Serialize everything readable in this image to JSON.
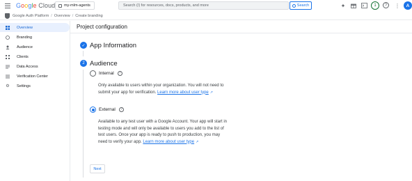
{
  "topbar": {
    "logo_text": "Google Cloud",
    "project_name": "my-mlm-agents",
    "search_placeholder": "Search (/) for resources, docs, products, and more",
    "search_button": "Search",
    "notification_count": "1",
    "avatar_initial": "A",
    "icons": [
      "menu-icon",
      "gemini-icon",
      "gift-icon",
      "terminal-icon",
      "help-icon",
      "more-vert-icon"
    ]
  },
  "breadcrumb": {
    "items": [
      "Google Auth Platform",
      "Overview",
      "Create branding"
    ],
    "separator": "/"
  },
  "sidebar": {
    "items": [
      {
        "label": "Overview",
        "icon": "grid-icon",
        "active": true
      },
      {
        "label": "Branding",
        "icon": "palette-icon",
        "active": false
      },
      {
        "label": "Audience",
        "icon": "people-icon",
        "active": false
      },
      {
        "label": "Clients",
        "icon": "clients-icon",
        "active": false
      },
      {
        "label": "Data Access",
        "icon": "data-access-icon",
        "active": false
      },
      {
        "label": "Verification Center",
        "icon": "verification-icon",
        "active": false
      },
      {
        "label": "Settings",
        "icon": "gear-icon",
        "active": false
      }
    ]
  },
  "main": {
    "page_title": "Project configuration",
    "steps": [
      {
        "number": "✓",
        "title": "App Information",
        "status": "done"
      },
      {
        "number": "2",
        "title": "Audience",
        "status": "current"
      }
    ],
    "options": [
      {
        "label": "Internal",
        "selected": false,
        "description": "Only available to users within your organization. You will not need to submit your app for verification.",
        "link": "Learn more about user type"
      },
      {
        "label": "External",
        "selected": true,
        "description": "Available to any test user with a Google Account. Your app will start in testing mode and will only be available to users you add to the list of test users. Once your app is ready to push to production, you may need to verify your app.",
        "link": "Learn more about user type"
      }
    ],
    "next_button": "Next"
  },
  "colors": {
    "accent": "#1a73e8",
    "active_nav_bg": "#e8f0fe",
    "text": "#202124",
    "border": "#dadce0"
  }
}
